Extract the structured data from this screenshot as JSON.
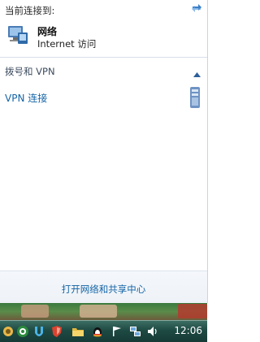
{
  "panel": {
    "connected_header": "当前连接到:",
    "network": {
      "name": "网络",
      "status": "Internet 访问"
    },
    "section": {
      "title": "拨号和 VPN"
    },
    "vpn": {
      "label": "VPN 连接"
    },
    "footer_link": "打开网络和共享中心"
  },
  "taskbar": {
    "clock": "12:06",
    "tray_icons": [
      "unknown-app-icon",
      "security-shield-icon",
      "u-app-icon",
      "shield-icon",
      "volume-control-icon",
      "folder-icon",
      "qq-penguin-icon",
      "flag-icon",
      "network-icon",
      "speaker-icon"
    ]
  },
  "colors": {
    "link": "#1565a6",
    "taskbar": "#1e4a44",
    "separator": "#d8dfe9"
  }
}
